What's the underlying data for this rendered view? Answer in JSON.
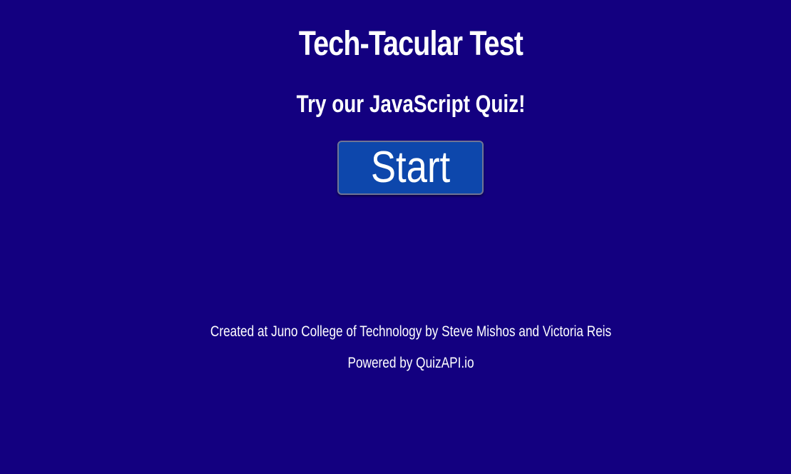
{
  "colors": {
    "background": "#130080",
    "button": "#0d47ac",
    "text": "#ffffff"
  },
  "header": {
    "title": "Tech-Tacular Test",
    "subtitle": "Try our JavaScript Quiz!"
  },
  "actions": {
    "start_label": "Start"
  },
  "footer": {
    "credits": "Created at Juno College of Technology by Steve Mishos and Victoria Reis",
    "powered_by": "Powered by QuizAPI.io"
  }
}
